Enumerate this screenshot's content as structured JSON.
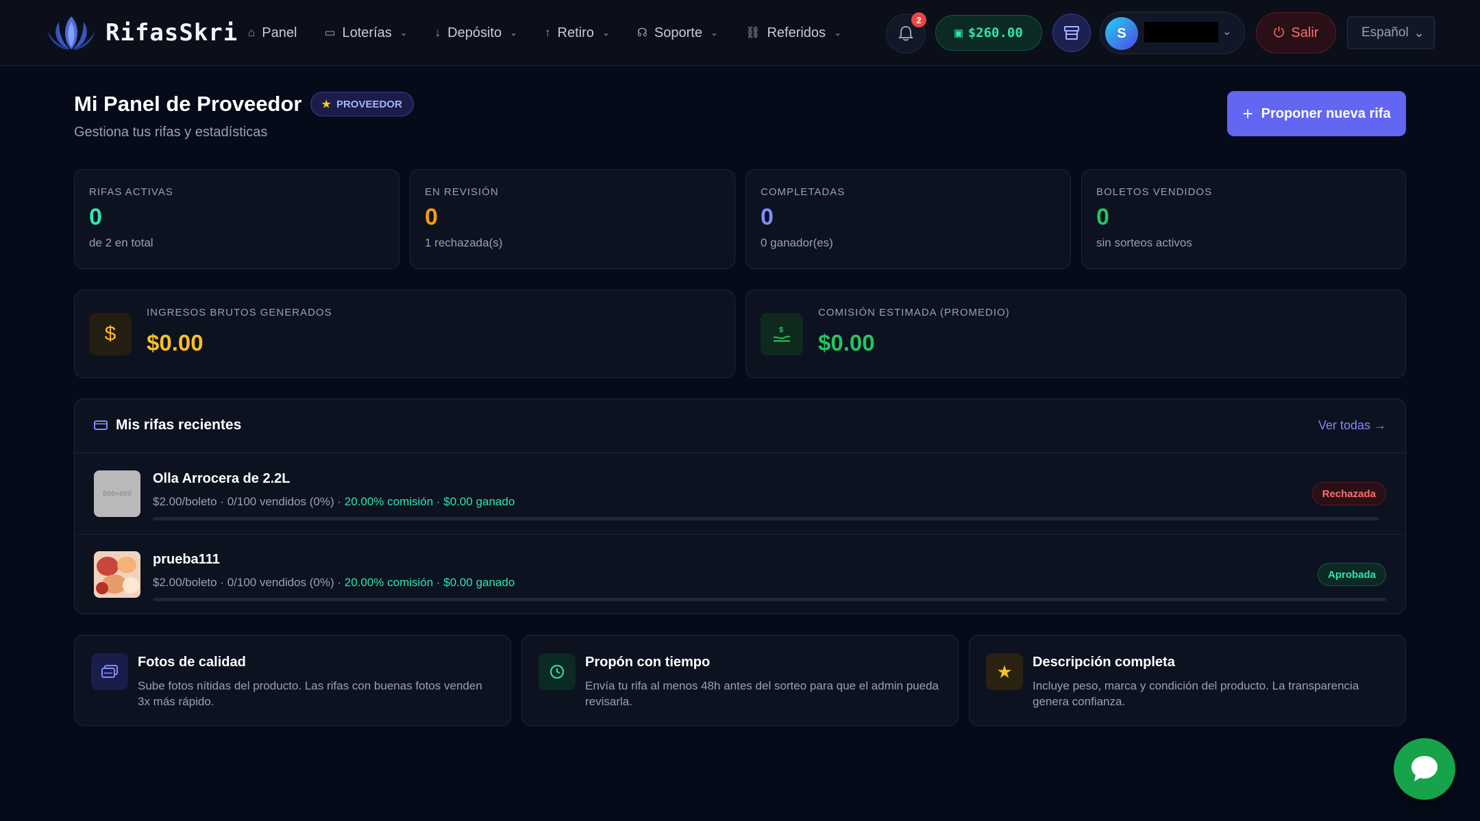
{
  "brand": {
    "name": "RifasSkri"
  },
  "nav": {
    "items": [
      {
        "label": "Panel",
        "icon": "home-icon"
      },
      {
        "label": "Loterías",
        "icon": "ticket-icon"
      },
      {
        "label": "Depósito",
        "icon": "arrow-down-icon"
      },
      {
        "label": "Retiro",
        "icon": "arrow-up-icon"
      },
      {
        "label": "Soporte",
        "icon": "headset-icon"
      },
      {
        "label": "Referidos",
        "icon": "link-icon"
      }
    ],
    "notifications_count": "2",
    "balance": "$260.00",
    "user_initial": "S",
    "logout_label": "Salir",
    "language": "Español"
  },
  "header": {
    "title": "Mi Panel de Proveedor",
    "badge": "PROVEEDOR",
    "subtitle": "Gestiona tus rifas y estadísticas",
    "propose_button": "Proponer nueva rifa"
  },
  "stats": [
    {
      "label": "RIFAS ACTIVAS",
      "value": "0",
      "sub": "de 2 en total",
      "color": "#2ee6b0"
    },
    {
      "label": "EN REVISIÓN",
      "value": "0",
      "sub": "1 rechazada(s)",
      "color": "#f59e0b"
    },
    {
      "label": "COMPLETADAS",
      "value": "0",
      "sub": "0 ganador(es)",
      "color": "#818cf8"
    },
    {
      "label": "BOLETOS VENDIDOS",
      "value": "0",
      "sub": "sin sorteos activos",
      "color": "#22c55e"
    }
  ],
  "money": [
    {
      "label": "INGRESOS BRUTOS GENERADOS",
      "value": "$0.00",
      "icon": "dollar-icon",
      "color": "#fbbf24"
    },
    {
      "label": "COMISIÓN ESTIMADA (PROMEDIO)",
      "value": "$0.00",
      "icon": "hand-coin-icon",
      "color": "#22c55e"
    }
  ],
  "recent": {
    "title": "Mis rifas recientes",
    "see_all": "Ver todas →",
    "rows": [
      {
        "name": "Olla Arrocera de 2.2L",
        "thumb_text": "800×800",
        "meta": "$2.00/boleto · 0/100 vendidos (0%) · ",
        "commission": "20.00% comisión · $0.00 ganado",
        "progress": 0,
        "status": "Rechazada",
        "status_color": "#f87171"
      },
      {
        "name": "prueba111",
        "thumb_text": "",
        "meta": "$2.00/boleto · 0/100 vendidos (0%) · ",
        "commission": "20.00% comisión · $0.00 ganado",
        "progress": 0,
        "status": "Aprobada",
        "status_color": "#2ee6b0"
      }
    ]
  },
  "tips": [
    {
      "title": "Fotos de calidad",
      "desc": "Sube fotos nítidas del producto. Las rifas con buenas fotos venden 3x más rápido.",
      "icon": "images-icon"
    },
    {
      "title": "Propón con tiempo",
      "desc": "Envía tu rifa al menos 48h antes del sorteo para que el admin pueda revisarla.",
      "icon": "clock-icon"
    },
    {
      "title": "Descripción completa",
      "desc": "Incluye peso, marca y condición del producto. La transparencia genera confianza.",
      "icon": "star-icon"
    }
  ]
}
